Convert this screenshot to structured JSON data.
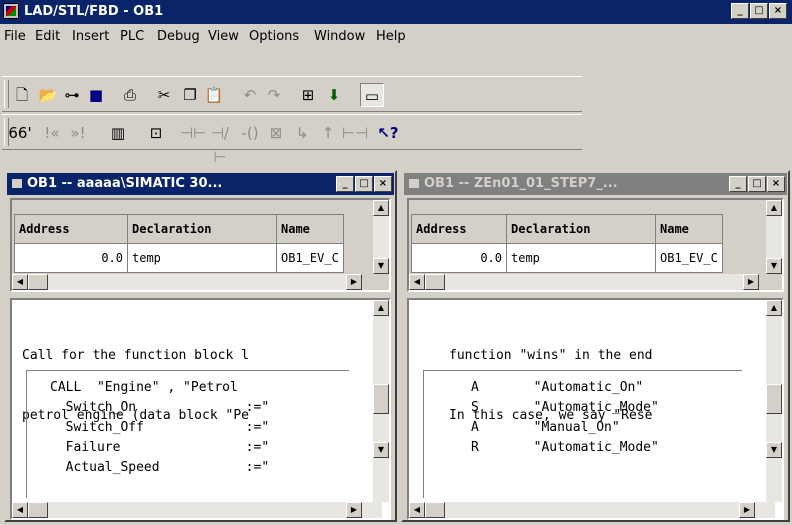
{
  "app": {
    "title": "LAD/STL/FBD  - OB1"
  },
  "menu": [
    "File",
    "Edit",
    "Insert",
    "PLC",
    "Debug",
    "View",
    "Options",
    "Window",
    "Help"
  ],
  "toolbar1": [
    "new-icon",
    "open-icon",
    "network-icon",
    "save-icon",
    "print-icon",
    "cut-icon",
    "copy-icon",
    "paste-icon",
    "undo-icon",
    "redo-icon",
    "monitor-icon",
    "download-icon",
    "overview-icon"
  ],
  "toolbar2": [
    "glasses-icon",
    "prev-network-icon",
    "next-network-icon",
    "catalog-icon",
    "new-network-icon",
    "contact-no-icon",
    "contact-nc-icon",
    "coil-icon",
    "box-icon",
    "branch-open-icon",
    "branch-close-icon",
    "connection-icon",
    "help-icon"
  ],
  "windows": [
    {
      "title": "OB1 -- aaaaa\\SIMATIC 30...",
      "columns": [
        "Address",
        "Declaration",
        "Name"
      ],
      "row": [
        "0.0",
        "temp",
        "OB1_EV_C"
      ],
      "comment": [
        "Call for the function block l",
        "petrol engine (data block \"Pe"
      ],
      "code": [
        "CALL  \"Engine\" , \"Petrol",
        "  Switch_On              :=\"",
        "  Switch_Off             :=\"",
        "  Failure                :=\"",
        "  Actual_Speed           :=\""
      ]
    },
    {
      "title": "OB1 -- ZEn01_01_STEP7_...",
      "columns": [
        "Address",
        "Declaration",
        "Name"
      ],
      "row": [
        "0.0",
        "temp",
        "OB1_EV_C"
      ],
      "comment": [
        "function \"wins\" in the end",
        "In this case, we say \"Rese"
      ],
      "code": [
        "A       \"Automatic_On\"",
        "S       \"Automatic_Mode\"",
        "A       \"Manual_On\"",
        "R       \"Automatic_Mode\""
      ]
    }
  ]
}
